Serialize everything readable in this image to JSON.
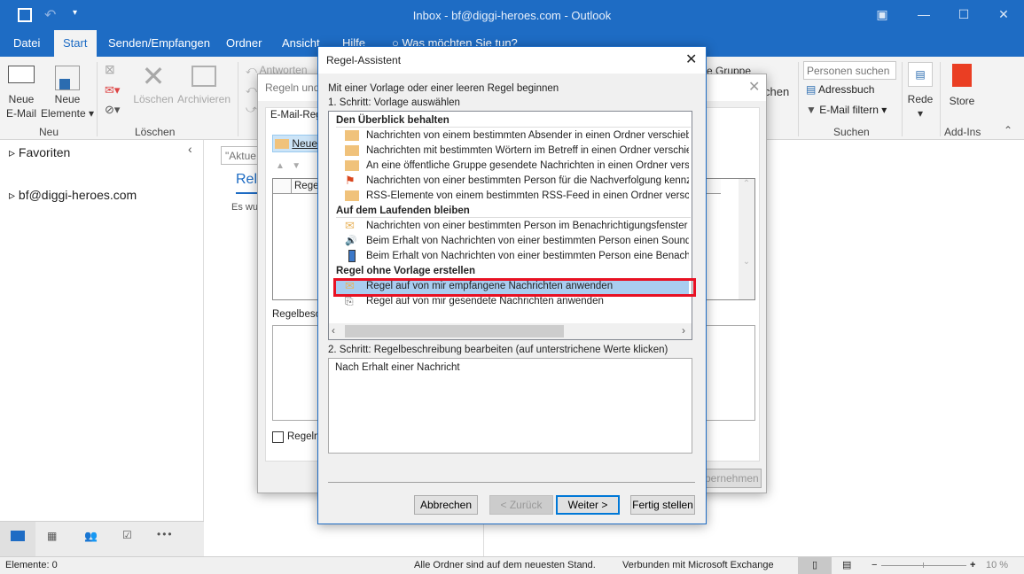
{
  "window": {
    "title": "Inbox - bf@diggi-heroes.com  -  Outlook"
  },
  "tabs": [
    "Datei",
    "Start",
    "Senden/Empfangen",
    "Ordner",
    "Ansicht",
    "Hilfe"
  ],
  "tell_me": "Was möchten Sie tun?",
  "ribbon": {
    "new_email": [
      "Neue",
      "E-Mail"
    ],
    "new_items": [
      "Neue",
      "Elemente"
    ],
    "group_new": "Neu",
    "delete": "Löschen",
    "archive": "Archivieren",
    "group_delete": "Löschen",
    "reply": "Antworten",
    "group_partial": "e Gruppe",
    "partial_chen": "chen",
    "search_people_placeholder": "Personen suchen",
    "address_book": "Adressbuch",
    "filter_email": "E-Mail filtern",
    "group_search": "Suchen",
    "speech": "Rede",
    "store": "Store",
    "group_addins": "Add-Ins"
  },
  "leftpane": {
    "favorites": "Favoriten",
    "account": "bf@diggi-heroes.com"
  },
  "middle": {
    "search_placeholder": "\"Aktue",
    "tab": "Rele",
    "empty": "Es wu"
  },
  "status": {
    "items": "Elemente: 0",
    "sync": "Alle Ordner sind auf dem neuesten Stand.",
    "connection": "Verbunden mit Microsoft Exchange",
    "zoom": "10 %"
  },
  "bg_dialog": {
    "title": "Regeln und",
    "tab": "E-Mail-Reg",
    "new_rule": "Neue",
    "col_rule": "Regel",
    "desc_label": "Regelbesc",
    "checkbox": "Regeln",
    "apply": "Übernehmen"
  },
  "wizard": {
    "title": "Regel-Assistent",
    "intro": "Mit einer Vorlage oder einer leeren Regel beginnen",
    "step1": "1. Schritt: Vorlage auswählen",
    "groups": [
      {
        "header": "Den Überblick behalten",
        "items": [
          {
            "icon": "move-folder",
            "label": "Nachrichten von einem bestimmten Absender in einen Ordner verschieben"
          },
          {
            "icon": "move-folder",
            "label": "Nachrichten mit bestimmten Wörtern im Betreff in einen Ordner verschieben"
          },
          {
            "icon": "move-folder",
            "label": "An eine öffentliche Gruppe gesendete Nachrichten in einen Ordner verschieben"
          },
          {
            "icon": "flag",
            "label": "Nachrichten von einer bestimmten Person für die Nachverfolgung kennzeichnen"
          },
          {
            "icon": "move-folder",
            "label": "RSS-Elemente von einem bestimmten RSS-Feed in einen Ordner verschieben"
          }
        ]
      },
      {
        "header": "Auf dem Laufenden bleiben",
        "items": [
          {
            "icon": "envelope-star",
            "label": "Nachrichten von einer bestimmten Person im Benachrichtigungsfenster"
          },
          {
            "icon": "speaker",
            "label": "Beim Erhalt von Nachrichten von einer bestimmten Person einen Sound"
          },
          {
            "icon": "mobile",
            "label": "Beim Erhalt von Nachrichten von einer bestimmten Person eine Benachr"
          }
        ]
      },
      {
        "header": "Regel ohne Vorlage erstellen",
        "items": [
          {
            "icon": "envelope",
            "label": "Regel auf von mir empfangene Nachrichten anwenden",
            "selected": true
          },
          {
            "icon": "sent",
            "label": "Regel auf von mir gesendete Nachrichten anwenden"
          }
        ]
      }
    ],
    "step2": "2. Schritt: Regelbeschreibung bearbeiten (auf unterstrichene Werte klicken)",
    "description": "Nach Erhalt einer Nachricht",
    "buttons": {
      "cancel": "Abbrechen",
      "back": "< Zurück",
      "next": "Weiter >",
      "finish": "Fertig stellen"
    },
    "highlight_color": "#e81123"
  }
}
